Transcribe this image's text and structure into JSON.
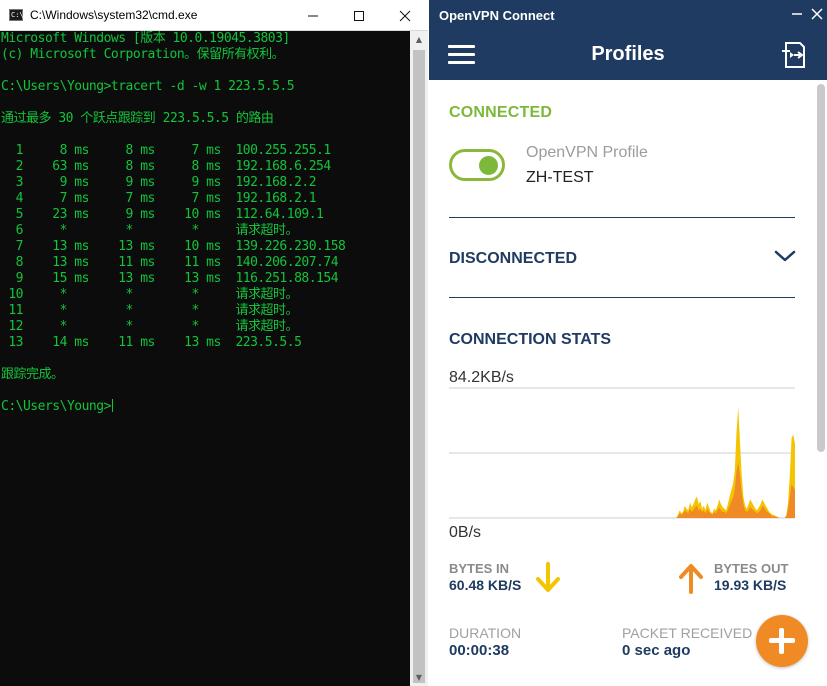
{
  "cmd": {
    "title": "C:\\Windows\\system32\\cmd.exe",
    "icon_label": "C:\\",
    "lines": [
      "Microsoft Windows [版本 10.0.19045.3803]",
      "(c) Microsoft Corporation。保留所有权利。",
      "",
      "C:\\Users\\Young>tracert -d -w 1 223.5.5.5",
      "",
      "通过最多 30 个跃点跟踪到 223.5.5.5 的路由",
      "",
      "  1     8 ms     8 ms     7 ms  100.255.255.1",
      "  2    63 ms     8 ms     8 ms  192.168.6.254",
      "  3     9 ms     9 ms     9 ms  192.168.2.2",
      "  4     7 ms     7 ms     7 ms  192.168.2.1",
      "  5    23 ms     9 ms    10 ms  112.64.109.1",
      "  6     *        *        *     请求超时。",
      "  7    13 ms    13 ms    10 ms  139.226.230.158",
      "  8    13 ms    11 ms    11 ms  140.206.207.74",
      "  9    15 ms    13 ms    13 ms  116.251.88.154",
      " 10     *        *        *     请求超时。",
      " 11     *        *        *     请求超时。",
      " 12     *        *        *     请求超时。",
      " 13    14 ms    11 ms    13 ms  223.5.5.5",
      "",
      "跟踪完成。",
      "",
      "C:\\Users\\Young>"
    ],
    "text_color": "#13c43a",
    "bg_color": "#0c0c0c"
  },
  "vpn": {
    "window_title": "OpenVPN Connect",
    "header_title": "Profiles",
    "status_connected": "CONNECTED",
    "profile_name": "OpenVPN Profile",
    "profile_server": "ZH-TEST",
    "status_disconnected": "DISCONNECTED",
    "stats_title": "CONNECTION STATS",
    "speed_max": "84.2KB/s",
    "speed_min": "0B/s",
    "bytes_in_label": "BYTES IN",
    "bytes_in_value": "60.48 KB/S",
    "bytes_out_label": "BYTES OUT",
    "bytes_out_value": "19.93 KB/S",
    "duration_label": "DURATION",
    "duration_value": "00:00:38",
    "packet_label": "PACKET RECEIVED",
    "packet_value": "0 sec ago",
    "colors": {
      "brand_navy": "#1f3b61",
      "connected_green": "#7cb83a",
      "bytes_in_yellow": "#f5c400",
      "bytes_out_orange": "#f08a24"
    },
    "icons": [
      "menu-icon",
      "import-profile-icon",
      "chevron-down-icon",
      "arrow-down-icon",
      "arrow-up-icon",
      "plus-icon"
    ]
  },
  "chart_data": {
    "type": "area",
    "ylabel": "",
    "ylim": [
      0,
      84.2
    ],
    "units": "KB/s",
    "series": [
      {
        "color": "#f5c400",
        "values": [
          0,
          0,
          0,
          0,
          0,
          0,
          0,
          0,
          0,
          0,
          0,
          0,
          0,
          0,
          0,
          0,
          0,
          0,
          0,
          0,
          0,
          0,
          0,
          0,
          0,
          0,
          0,
          0,
          0,
          0,
          0,
          0,
          0,
          0,
          0,
          0,
          0,
          0,
          0,
          0,
          0,
          0,
          0,
          0,
          0,
          0,
          0,
          0,
          0,
          0,
          0,
          0,
          0,
          0,
          0,
          0,
          0,
          0,
          0,
          0,
          0,
          0,
          0,
          0,
          0,
          0,
          0,
          0,
          0,
          0,
          0,
          0,
          0,
          0,
          0,
          0,
          0,
          0,
          0,
          0,
          0,
          0,
          0,
          0,
          0,
          0,
          0,
          0,
          0,
          0,
          0,
          0,
          0,
          0,
          0,
          0,
          0,
          0,
          0,
          0,
          0,
          0,
          0,
          0,
          0,
          0,
          0,
          0,
          0,
          0,
          0,
          0,
          0,
          0,
          0,
          0,
          0,
          0,
          0,
          0,
          0,
          0,
          0,
          0,
          0,
          0,
          0,
          0,
          0,
          0,
          0,
          0,
          0,
          2,
          5,
          3,
          4,
          8,
          6,
          5,
          10,
          7,
          9,
          12,
          14,
          9,
          11,
          6,
          8,
          5,
          10,
          7,
          4,
          3,
          6,
          5,
          8,
          12,
          9,
          7,
          6,
          5,
          9,
          14,
          18,
          22,
          30,
          55,
          72,
          50,
          28,
          14,
          8,
          6,
          9,
          12,
          10,
          8,
          6,
          5,
          7,
          9,
          12,
          10,
          8,
          6,
          4,
          3,
          2,
          2,
          1,
          1,
          0,
          0,
          0,
          0,
          2,
          10,
          28,
          52,
          54,
          48
        ]
      },
      {
        "color": "#f08a24",
        "values": [
          0,
          0,
          0,
          0,
          0,
          0,
          0,
          0,
          0,
          0,
          0,
          0,
          0,
          0,
          0,
          0,
          0,
          0,
          0,
          0,
          0,
          0,
          0,
          0,
          0,
          0,
          0,
          0,
          0,
          0,
          0,
          0,
          0,
          0,
          0,
          0,
          0,
          0,
          0,
          0,
          0,
          0,
          0,
          0,
          0,
          0,
          0,
          0,
          0,
          0,
          0,
          0,
          0,
          0,
          0,
          0,
          0,
          0,
          0,
          0,
          0,
          0,
          0,
          0,
          0,
          0,
          0,
          0,
          0,
          0,
          0,
          0,
          0,
          0,
          0,
          0,
          0,
          0,
          0,
          0,
          0,
          0,
          0,
          0,
          0,
          0,
          0,
          0,
          0,
          0,
          0,
          0,
          0,
          0,
          0,
          0,
          0,
          0,
          0,
          0,
          0,
          0,
          0,
          0,
          0,
          0,
          0,
          0,
          0,
          0,
          0,
          0,
          0,
          0,
          0,
          0,
          0,
          0,
          0,
          0,
          0,
          0,
          0,
          0,
          0,
          0,
          0,
          0,
          0,
          0,
          0,
          0,
          0,
          1,
          3,
          2,
          3,
          5,
          4,
          3,
          6,
          4,
          5,
          7,
          8,
          5,
          6,
          4,
          5,
          3,
          6,
          4,
          3,
          2,
          4,
          3,
          5,
          7,
          5,
          4,
          4,
          3,
          5,
          8,
          11,
          13,
          18,
          30,
          36,
          28,
          16,
          9,
          5,
          4,
          5,
          7,
          6,
          5,
          4,
          3,
          4,
          5,
          8,
          7,
          5,
          4,
          3,
          2,
          1,
          1,
          1,
          0,
          0,
          0,
          0,
          0,
          1,
          6,
          14,
          22,
          20,
          18
        ]
      }
    ]
  }
}
